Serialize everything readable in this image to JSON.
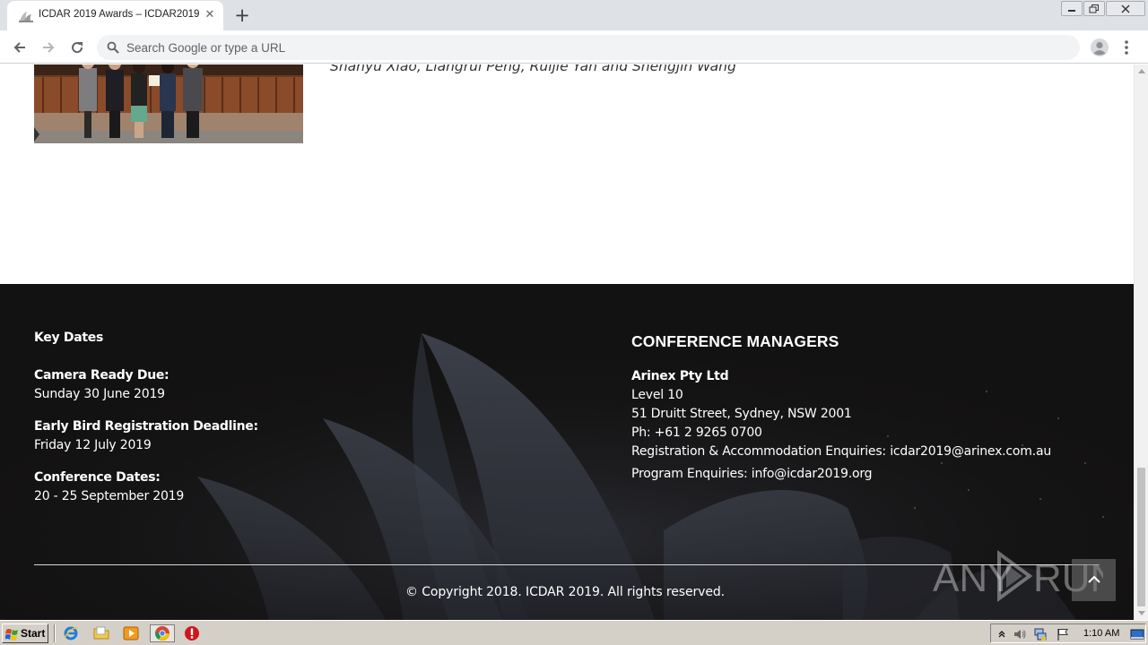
{
  "browser": {
    "tab_title": "ICDAR 2019 Awards – ICDAR2019",
    "tab_close": "✕",
    "new_tab": "+",
    "omnibox_placeholder": "Search Google or type a URL"
  },
  "page": {
    "award_authors": "Shanyu Xiao, Liangrui Peng, Ruijie Yan and Shengjin Wang"
  },
  "footer": {
    "key_dates_title": "Key Dates",
    "key_dates": [
      {
        "label": "Camera Ready Due:",
        "value": "Sunday 30 June 2019"
      },
      {
        "label": "Early Bird Registration Deadline:",
        "value": "Friday 12 July 2019"
      },
      {
        "label": "Conference Dates:",
        "value": "20 - 25  September 2019"
      }
    ],
    "managers_title": "CONFERENCE MANAGERS",
    "company": "Arinex Pty Ltd",
    "address_line1": "Level 10",
    "address_line2": "51 Druitt Street, Sydney, NSW 2001",
    "phone": "Ph: +61 2 9265 0700",
    "registration_enquiries": "Registration & Accommodation Enquiries: icdar2019@arinex.com.au",
    "program_enquiries": "Program Enquiries: info@icdar2019.org",
    "copyright": "© Copyright 2018. ICDAR 2019. All rights reserved."
  },
  "watermark": {
    "text": "ANY RUN"
  },
  "taskbar": {
    "start_label": "Start",
    "clock": "1:10 AM"
  },
  "colors": {
    "footer_bg": "#131212",
    "footer_text": "#ffffff",
    "taskbar_bg": "#d4d0c8",
    "chrome_tabstrip": "#dee1e6",
    "omnibox_bg": "#f1f3f4"
  },
  "icons": [
    "search-icon",
    "back-icon",
    "forward-icon",
    "reload-icon",
    "profile-icon",
    "menu-icon",
    "minimize-icon",
    "maximize-icon",
    "close-icon",
    "chevron-up-icon",
    "windows-logo-icon",
    "ie-icon",
    "folder-icon",
    "media-player-icon",
    "chrome-icon",
    "stop-icon",
    "volume-icon",
    "network-icon",
    "flag-icon"
  ]
}
